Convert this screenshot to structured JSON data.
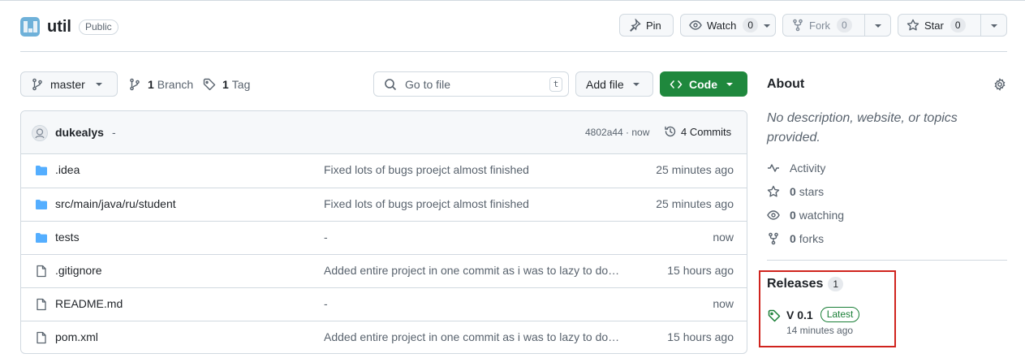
{
  "repo": {
    "name": "util",
    "visibility": "Public"
  },
  "header": {
    "pin_label": "Pin",
    "watch_label": "Watch",
    "watch_count": "0",
    "fork_label": "Fork",
    "fork_count": "0",
    "star_label": "Star",
    "star_count": "0"
  },
  "toolbar": {
    "branch": "master",
    "branch_count": "1",
    "branch_label": "Branch",
    "tag_count": "1",
    "tag_label": "Tag",
    "search_placeholder": "Go to file",
    "search_shortcut": "t",
    "add_file_label": "Add file",
    "code_label": "Code"
  },
  "commit": {
    "author": "dukealys",
    "dash": "-",
    "sha_time": "4802a44 · now",
    "commits_label": "4 Commits"
  },
  "files": [
    {
      "type": "folder",
      "name": ".idea",
      "message": "Fixed lots of bugs proejct almost finished",
      "date": "25 minutes ago"
    },
    {
      "type": "folder",
      "name": "src/main/java/ru/student",
      "message": "Fixed lots of bugs proejct almost finished",
      "date": "25 minutes ago"
    },
    {
      "type": "folder",
      "name": "tests",
      "message": "-",
      "date": "now"
    },
    {
      "type": "file",
      "name": ".gitignore",
      "message": "Added entire project in one commit as i was to lazy to do…",
      "date": "15 hours ago"
    },
    {
      "type": "file",
      "name": "README.md",
      "message": "-",
      "date": "now"
    },
    {
      "type": "file",
      "name": "pom.xml",
      "message": "Added entire project in one commit as i was to lazy to do…",
      "date": "15 hours ago"
    }
  ],
  "about": {
    "title": "About",
    "description": "No description, website, or topics provided.",
    "activity_label": "Activity",
    "stars_count": "0",
    "stars_label": "stars",
    "watching_count": "0",
    "watching_label": "watching",
    "forks_count": "0",
    "forks_label": "forks"
  },
  "releases": {
    "title": "Releases",
    "count": "1",
    "latest_name": "V 0.1",
    "latest_badge": "Latest",
    "latest_date": "14 minutes ago"
  },
  "colors": {
    "primary_green": "#1f883d",
    "folder_blue": "#54aeff",
    "highlight_red": "#d0241e",
    "latest_green": "#1a7f37"
  },
  "icons": {
    "folder": "folder-icon",
    "file": "file-icon"
  }
}
